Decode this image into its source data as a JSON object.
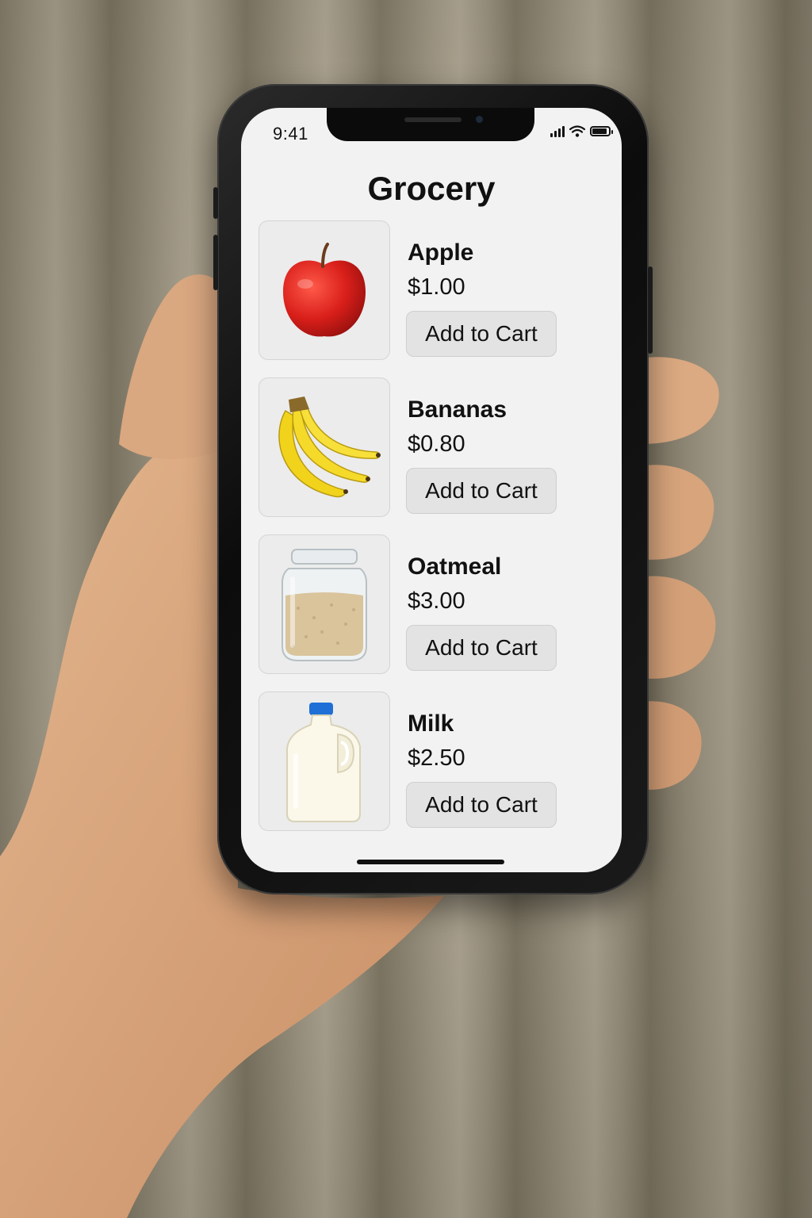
{
  "status_bar": {
    "time": "9:41"
  },
  "page": {
    "title": "Grocery"
  },
  "products": [
    {
      "name": "Apple",
      "price": "$1.00",
      "button_label": "Add to Cart",
      "icon": "apple-icon"
    },
    {
      "name": "Bananas",
      "price": "$0.80",
      "button_label": "Add to Cart",
      "icon": "bananas-icon"
    },
    {
      "name": "Oatmeal",
      "price": "$3.00",
      "button_label": "Add to Cart",
      "icon": "oatmeal-jar-icon"
    },
    {
      "name": "Milk",
      "price": "$2.50",
      "button_label": "Add to Cart",
      "icon": "milk-jug-icon"
    }
  ],
  "colors": {
    "screen_bg": "#f2f2f2",
    "button_bg": "#e3e3e3",
    "text": "#111111"
  }
}
